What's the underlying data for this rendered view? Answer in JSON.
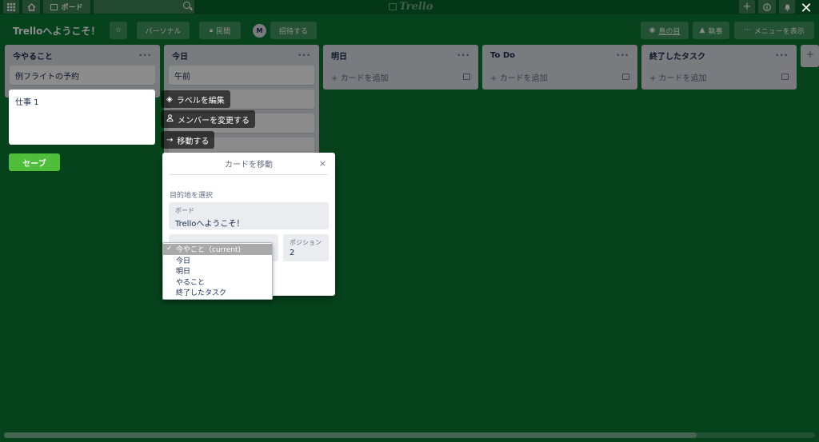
{
  "topbar": {
    "boards_label": "ボード",
    "logo_text": "Trello"
  },
  "board": {
    "title": "Trelloへようこそ！",
    "personal_label": "パーソナル",
    "visibility_label": "民間",
    "avatar_initial": "M",
    "invite_label": "招待する",
    "watch_label": "島の目",
    "butler_label": "執事",
    "menu_label": "メニューを表示"
  },
  "lists": [
    {
      "title": "今やること",
      "cards": [
        "例フライトの予約"
      ]
    },
    {
      "title": "今日",
      "cards": [
        "午前"
      ]
    },
    {
      "title": "明日",
      "add_label": "カードを追加"
    },
    {
      "title": "To Do",
      "add_label": "カードを追加"
    },
    {
      "title": "終了したタスク",
      "add_label": "カードを追加"
    }
  ],
  "quick_edit": {
    "card_text": "仕事 1",
    "save_label": "セーブ",
    "actions": [
      "ラベルを編集",
      "メンバーを変更する",
      "移動する"
    ]
  },
  "move_popover": {
    "title": "カードを移動",
    "close_symbol": "×",
    "select_destination": "目的地を選択",
    "board_label": "ボード",
    "board_value": "Trelloへようこそ！",
    "position_label": "ポジション",
    "position_value": "2"
  },
  "list_dropdown": {
    "options": [
      "今やこと（current)",
      "今日",
      "明日",
      "やること",
      "終了したタスク"
    ],
    "selected_index": 0
  },
  "colors": {
    "board_background": "#0b7a33",
    "save_button": "#4fbe3a",
    "list_background": "#dfe1e6"
  }
}
